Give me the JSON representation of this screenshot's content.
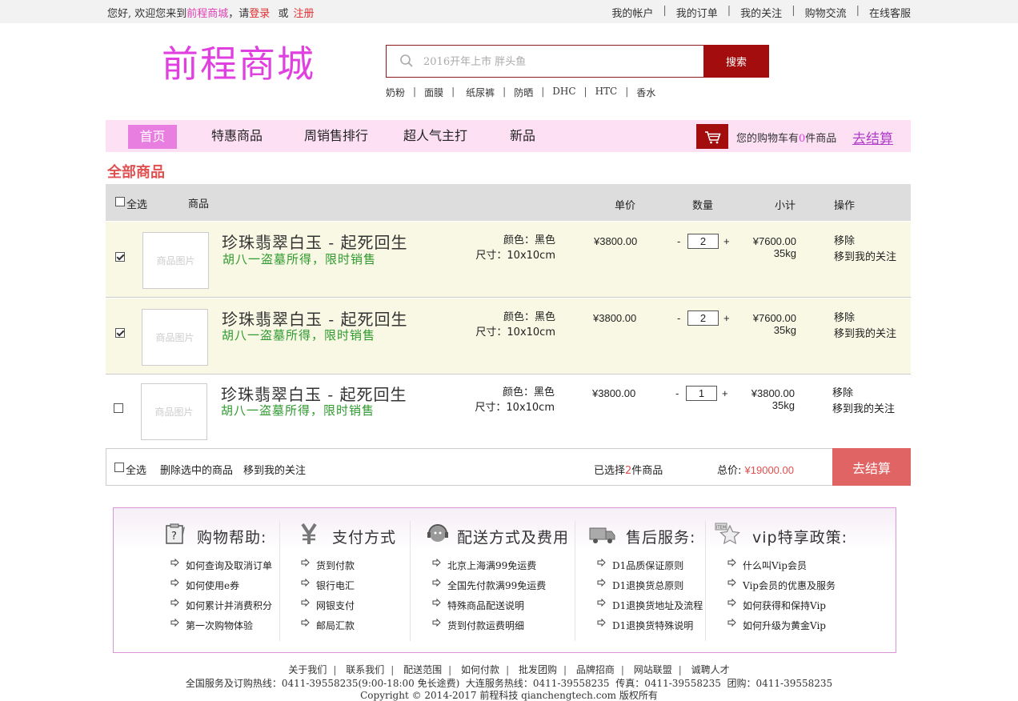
{
  "topbar": {
    "welcome_prefix": "您好, 欢迎您来到",
    "brand": "前程商城",
    "welcome_mid": "，请",
    "login": "登录",
    "or": "或",
    "register": "注册",
    "links": [
      "我的帐户",
      "我的订单",
      "我的关注",
      "购物交流",
      "在线客服"
    ]
  },
  "header": {
    "logo": "前程商城",
    "search_placeholder": "2016开年上市 胖头鱼",
    "search_button": "搜索",
    "hotwords": [
      "奶粉",
      "面膜",
      "纸尿裤",
      "防晒",
      "DHC",
      "HTC",
      "香水"
    ]
  },
  "nav": {
    "items": [
      "首页",
      "特惠商品",
      "周销售排行",
      "超人气主打",
      "新品"
    ],
    "cart_prefix": "您的购物车有",
    "cart_count": "0",
    "cart_suffix": "件商品",
    "checkout": "去结算",
    "cart_icon": "shopping-cart-icon"
  },
  "section_title": "全部商品",
  "table": {
    "select_all": "全选",
    "headers": {
      "product": "商品",
      "price": "单价",
      "qty": "数量",
      "subtotal": "小计",
      "ops": "操作"
    },
    "rows": [
      {
        "checked": true,
        "pic": "商品图片",
        "name": "珍珠翡翠白玉 - 起死回生",
        "sub": "胡八一盗墓所得，限时销售",
        "color": "颜色：黑色",
        "size": "尺寸：10x10cm",
        "price": "¥3800.00",
        "minus": "-",
        "qty": "2",
        "plus": "+",
        "subtotal": "¥7600.00",
        "weight": "35kg",
        "remove": "移除",
        "follow": "移到我的关注"
      },
      {
        "checked": true,
        "pic": "商品图片",
        "name": "珍珠翡翠白玉 - 起死回生",
        "sub": "胡八一盗墓所得，限时销售",
        "color": "颜色：黑色",
        "size": "尺寸：10x10cm",
        "price": "¥3800.00",
        "minus": "-",
        "qty": "2",
        "plus": "+",
        "subtotal": "¥7600.00",
        "weight": "35kg",
        "remove": "移除",
        "follow": "移到我的关注"
      },
      {
        "checked": false,
        "pic": "商品图片",
        "name": "珍珠翡翠白玉 - 起死回生",
        "sub": "胡八一盗墓所得，限时销售",
        "color": "颜色：黑色",
        "size": "尺寸：10x10cm",
        "price": "¥3800.00",
        "minus": "-",
        "qty": "1",
        "plus": "+",
        "subtotal": "¥3800.00",
        "weight": "35kg",
        "remove": "移除",
        "follow": "移到我的关注"
      }
    ]
  },
  "footer_bar": {
    "select_all": "全选",
    "delete_selected": "删除选中的商品",
    "move_follow": "移到我的关注",
    "selected_prefix": "已选择",
    "selected_count": "2",
    "selected_suffix": "件商品",
    "total_label": "总价:",
    "total": "¥19000.00",
    "checkout": "去结算"
  },
  "help": {
    "columns": [
      {
        "title": "购物帮助:",
        "icon": "help-document-icon",
        "items": [
          "如何查询及取消订单",
          "如何使用e券",
          "如何累计并消费积分",
          "第一次购物体验"
        ]
      },
      {
        "title": "支付方式",
        "icon": "yen-icon",
        "items": [
          "货到付款",
          "银行电汇",
          "网银支付",
          "邮局汇款"
        ]
      },
      {
        "title": "配送方式及费用",
        "icon": "headset-icon",
        "items": [
          "北京上海满99免运费",
          "全国先付款满99免运费",
          "特殊商品配送说明",
          "货到付款运费明细"
        ]
      },
      {
        "title": "售后服务:",
        "icon": "truck-icon",
        "items": [
          "D1品质保证原则",
          "D1退换货总原则",
          "D1退换货地址及流程",
          "D1退换货特殊说明"
        ]
      },
      {
        "title": "vip特享政策:",
        "icon": "vip-star-icon",
        "items": [
          "什么叫Vip会员",
          "Vip会员的优惠及服务",
          "如何获得和保持Vip",
          "如何升级为黄金Vip"
        ]
      }
    ]
  },
  "bottom": {
    "links": [
      "关于我们",
      "联系我们",
      "配送范围",
      "如何付款",
      "批发团购",
      "品牌招商",
      "网站联盟",
      "诚聘人才"
    ],
    "hotline": "全国服务及订购热线：0411-39558235(9:00-18:00 免长途费)  大连服务热线：0411-39558235  传真：0411-39558235  团购：0411-39558235",
    "copyright": "Copyright © 2014-2017  前程科技 qianchengtech.com 版权所有"
  }
}
